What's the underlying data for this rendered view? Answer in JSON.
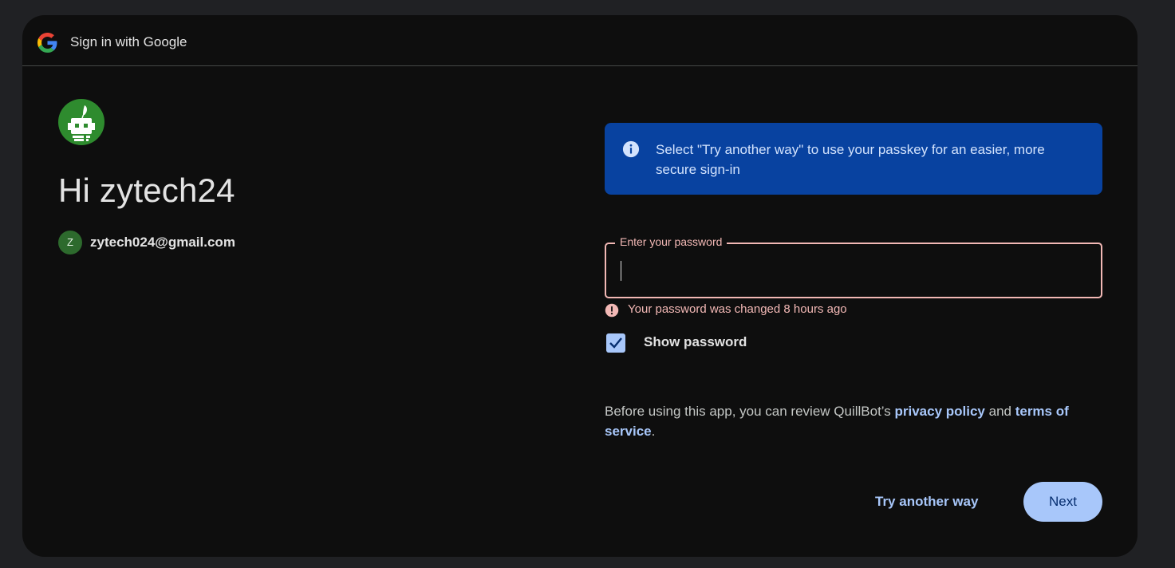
{
  "header": {
    "title": "Sign in with Google",
    "logo_icon": "google-g-icon"
  },
  "app": {
    "logo_icon": "quillbot-robot-logo",
    "brand_color": "#2e8b2e"
  },
  "account": {
    "greeting": "Hi zytech24",
    "avatar_letter": "Z",
    "email": "zytech024@gmail.com"
  },
  "info_banner": {
    "icon": "info-icon",
    "text": "Select \"Try another way\" to use your passkey for an easier, more secure sign-in",
    "background": "#0842a0"
  },
  "password_field": {
    "label": "Enter your password",
    "value": "",
    "error_icon": "error-icon",
    "error_text": "Your password was changed 8 hours ago",
    "error_color": "#f2b8b5"
  },
  "show_password": {
    "label": "Show password",
    "checked": true
  },
  "disclaimer": {
    "prefix": "Before using this app, you can review QuillBot’s ",
    "privacy_link": "privacy policy",
    "middle": " and ",
    "terms_link": "terms of service",
    "suffix": "."
  },
  "actions": {
    "try_another_way": "Try another way",
    "next": "Next",
    "accent": "#a8c7fa"
  }
}
